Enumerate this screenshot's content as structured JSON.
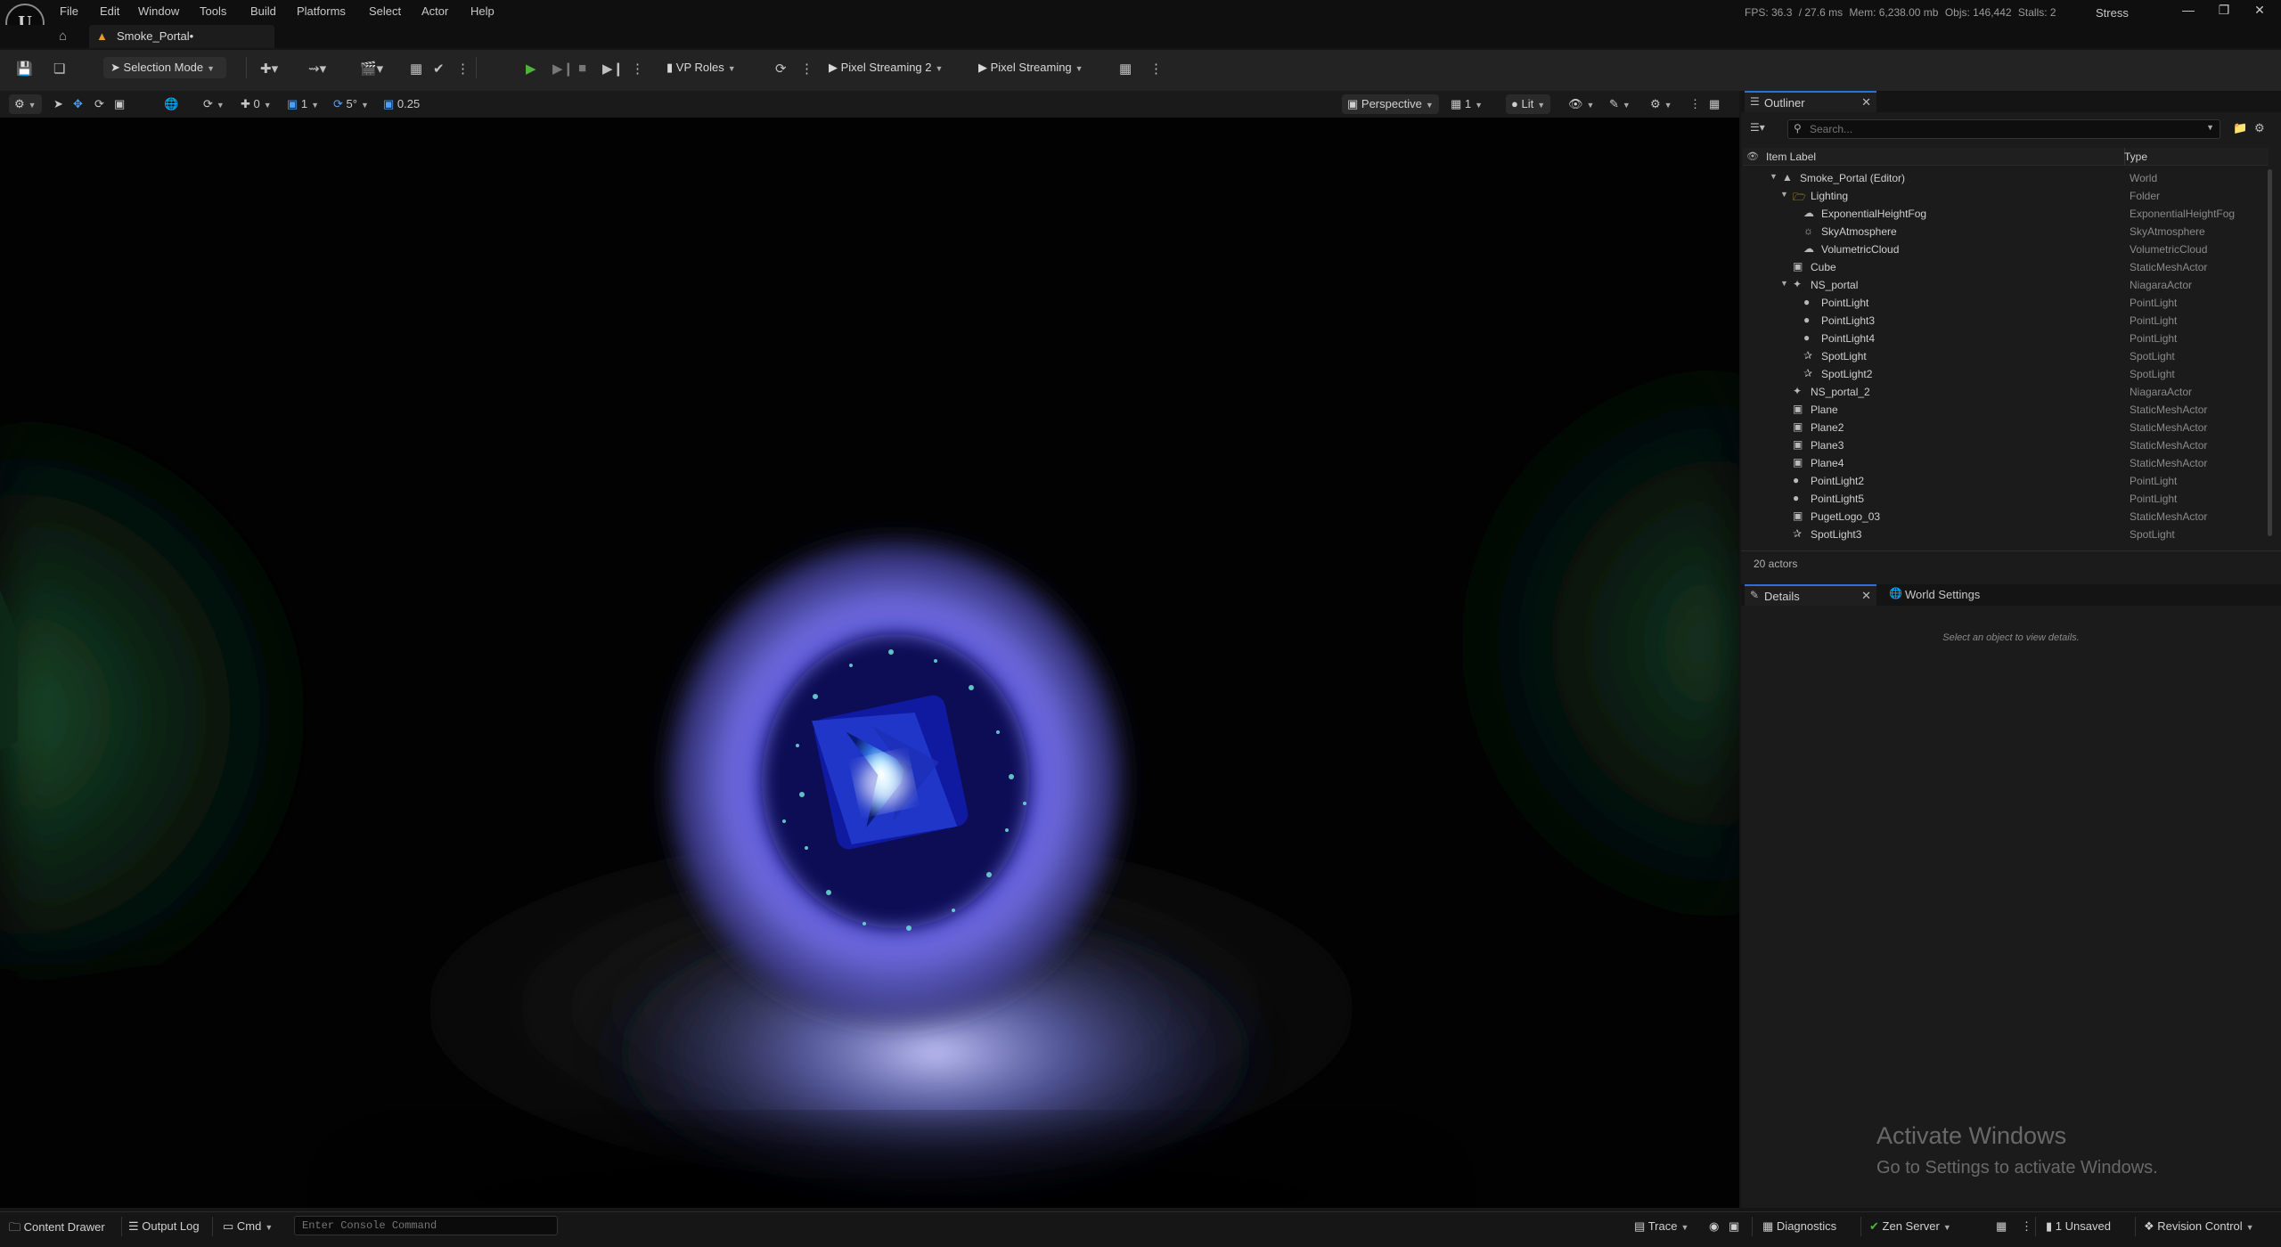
{
  "app": {
    "menus": [
      "File",
      "Edit",
      "Window",
      "Tools",
      "Build",
      "Platforms",
      "Select",
      "Actor",
      "Help"
    ],
    "document_tab": "Smoke_Portal•",
    "stats": {
      "fps": "FPS: 36.3",
      "ms": "/ 27.6 ms",
      "mem": "Mem: 6,238.00 mb",
      "objs": "Objs: 146,442",
      "stalls": "Stalls: 2"
    },
    "stress_label": "Stress"
  },
  "toolbar": {
    "selection_mode": "Selection Mode",
    "vp_roles": "VP Roles",
    "pixel_streaming_2": "Pixel Streaming 2",
    "pixel_streaming": "Pixel Streaming"
  },
  "viewport_toolbar": {
    "translate_snap": "0",
    "rotate_snap_label": "1",
    "angle_snap": "5°",
    "scale_snap": "0.25",
    "view_mode": "Perspective",
    "camera_speed": "1",
    "lighting_mode": "Lit"
  },
  "outliner": {
    "tab_label": "Outliner",
    "search_placeholder": "Search...",
    "col_label": "Item Label",
    "col_type": "Type",
    "rows": [
      {
        "label": "Smoke_Portal (Editor)",
        "type": "World"
      },
      {
        "label": "Lighting",
        "type": "Folder"
      },
      {
        "label": "ExponentialHeightFog",
        "type": "ExponentialHeightFog"
      },
      {
        "label": "SkyAtmosphere",
        "type": "SkyAtmosphere"
      },
      {
        "label": "VolumetricCloud",
        "type": "VolumetricCloud"
      },
      {
        "label": "Cube",
        "type": "StaticMeshActor"
      },
      {
        "label": "NS_portal",
        "type": "NiagaraActor"
      },
      {
        "label": "PointLight",
        "type": "PointLight"
      },
      {
        "label": "PointLight3",
        "type": "PointLight"
      },
      {
        "label": "PointLight4",
        "type": "PointLight"
      },
      {
        "label": "SpotLight",
        "type": "SpotLight"
      },
      {
        "label": "SpotLight2",
        "type": "SpotLight"
      },
      {
        "label": "NS_portal_2",
        "type": "NiagaraActor"
      },
      {
        "label": "Plane",
        "type": "StaticMeshActor"
      },
      {
        "label": "Plane2",
        "type": "StaticMeshActor"
      },
      {
        "label": "Plane3",
        "type": "StaticMeshActor"
      },
      {
        "label": "Plane4",
        "type": "StaticMeshActor"
      },
      {
        "label": "PointLight2",
        "type": "PointLight"
      },
      {
        "label": "PointLight5",
        "type": "PointLight"
      },
      {
        "label": "PugetLogo_03",
        "type": "StaticMeshActor"
      },
      {
        "label": "SpotLight3",
        "type": "SpotLight"
      }
    ],
    "actor_count": "20 actors"
  },
  "details": {
    "tab_label": "Details",
    "world_settings_label": "World Settings",
    "hint": "Select an object to view details."
  },
  "watermark": {
    "line1": "Activate Windows",
    "line2": "Go to Settings to activate Windows."
  },
  "statusbar": {
    "content_drawer": "Content Drawer",
    "output_log": "Output Log",
    "cmd": "Cmd",
    "console_placeholder": "Enter Console Command",
    "trace": "Trace",
    "diagnostics": "Diagnostics",
    "zen_server": "Zen Server",
    "unsaved": "1 Unsaved",
    "revision_control": "Revision Control"
  }
}
